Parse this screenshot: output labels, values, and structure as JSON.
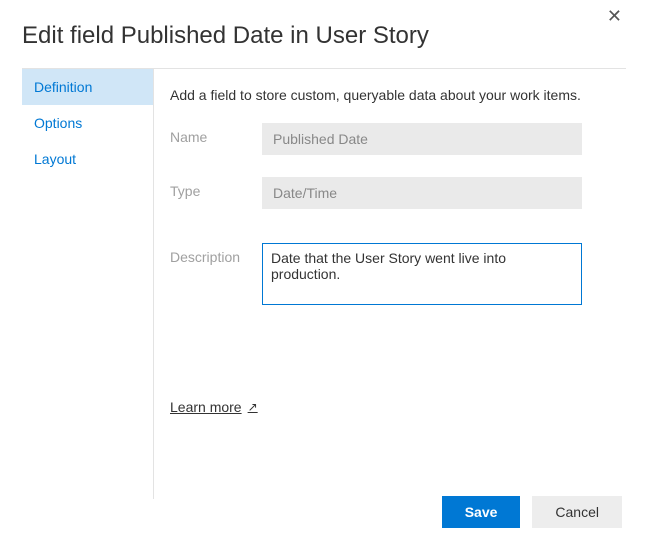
{
  "dialog": {
    "title": "Edit field Published Date in User Story",
    "close_label": "✕"
  },
  "sidebar": {
    "items": [
      {
        "label": "Definition",
        "active": true
      },
      {
        "label": "Options",
        "active": false
      },
      {
        "label": "Layout",
        "active": false
      }
    ]
  },
  "pane": {
    "intro": "Add a field to store custom, queryable data about your work items.",
    "name_label": "Name",
    "name_value": "Published Date",
    "type_label": "Type",
    "type_value": "Date/Time",
    "description_label": "Description",
    "description_value": "Date that the User Story went live into production.",
    "learn_more": "Learn more"
  },
  "footer": {
    "save": "Save",
    "cancel": "Cancel"
  },
  "icons": {
    "external": "↗"
  }
}
